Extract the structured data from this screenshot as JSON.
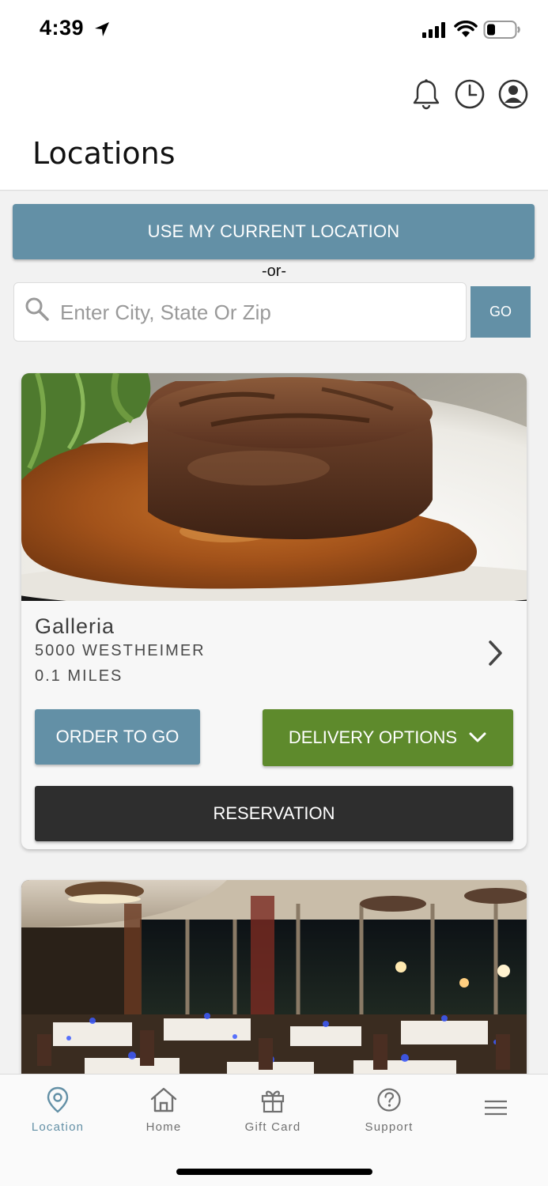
{
  "status": {
    "time": "4:39"
  },
  "header": {
    "title": "Locations"
  },
  "location_button": "USE MY CURRENT LOCATION",
  "or_text": "-or-",
  "search": {
    "placeholder": "Enter City, State Or Zip",
    "value": "",
    "go_label": "GO"
  },
  "locations": [
    {
      "name": "Galleria",
      "address": "5000 WESTHEIMER",
      "distance": "0.1 MILES",
      "order_label": "ORDER TO GO",
      "delivery_label": "DELIVERY OPTIONS",
      "reservation_label": "RESERVATION"
    }
  ],
  "tabs": [
    {
      "label": "Location",
      "icon": "location-pin-icon",
      "active": true
    },
    {
      "label": "Home",
      "icon": "home-icon"
    },
    {
      "label": "Gift Card",
      "icon": "gift-icon"
    },
    {
      "label": "Support",
      "icon": "help-circle-icon"
    },
    {
      "label": "",
      "icon": "menu-icon"
    }
  ],
  "colors": {
    "accent": "#6390a6",
    "delivery": "#5e8a2c",
    "reservation": "#2e2e2e"
  }
}
